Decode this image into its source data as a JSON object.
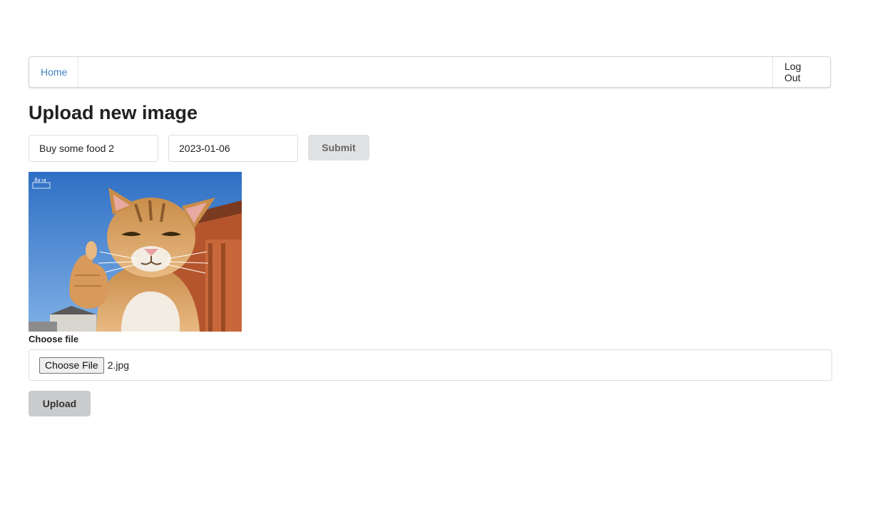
{
  "nav": {
    "home_label": "Home",
    "logout_label": "Log Out"
  },
  "page": {
    "title": "Upload new image"
  },
  "form": {
    "title_value": "Buy some food 2",
    "date_value": "2023-01-06",
    "submit_label": "Submit"
  },
  "upload": {
    "label": "Choose file",
    "choose_button_label": "Choose File",
    "file_name": "2.jpg",
    "upload_button_label": "Upload"
  },
  "colors": {
    "link": "#4183c4",
    "submit_bg": "#e0e1e2",
    "upload_bg": "#cacbcd",
    "sky": "#3b7fd0"
  }
}
